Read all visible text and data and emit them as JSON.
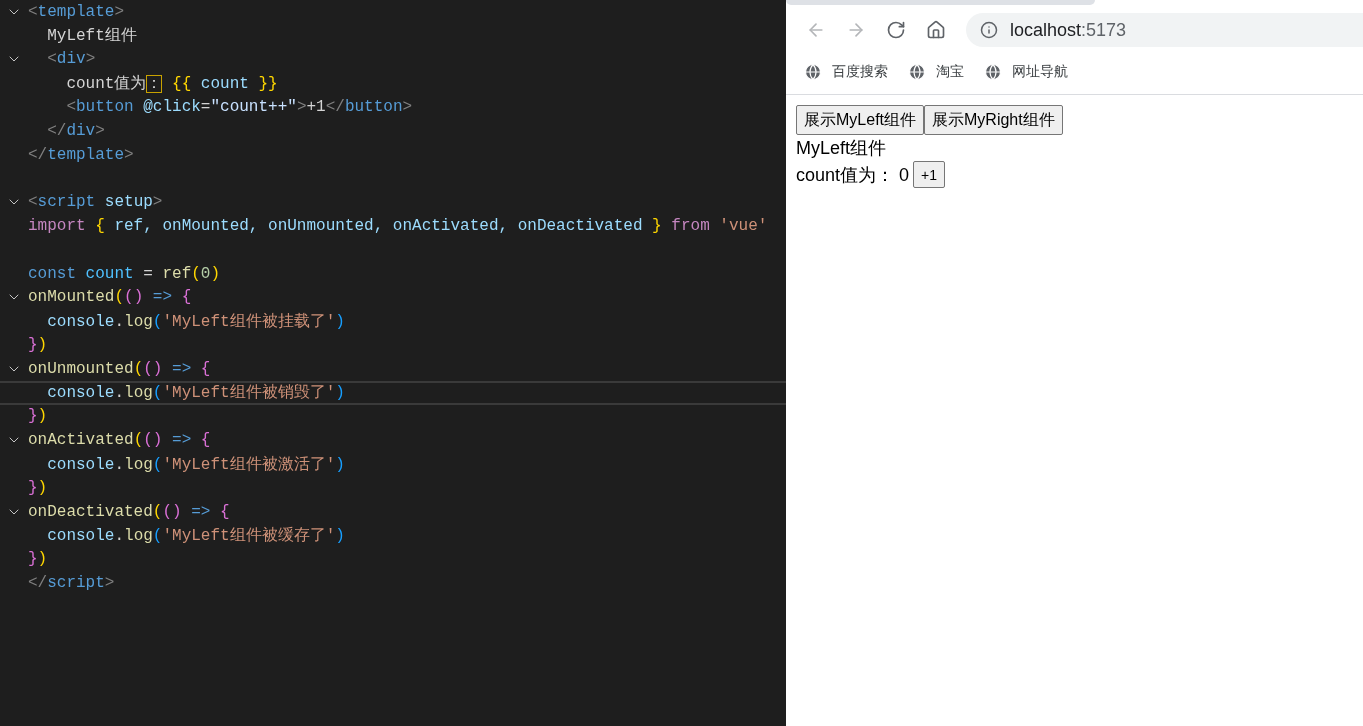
{
  "editor": {
    "lines": [
      {
        "fold": true,
        "current": false,
        "tokens": [
          {
            "text": "<",
            "kind": "punct"
          },
          {
            "text": "template",
            "kind": "tag"
          },
          {
            "text": ">",
            "kind": "punct"
          }
        ]
      },
      {
        "fold": false,
        "current": false,
        "tokens": [
          {
            "text": "  MyLeft组件",
            "kind": "plain"
          }
        ]
      },
      {
        "fold": true,
        "current": false,
        "tokens": [
          {
            "text": "  <",
            "kind": "punct"
          },
          {
            "text": "div",
            "kind": "tag"
          },
          {
            "text": ">",
            "kind": "punct"
          }
        ]
      },
      {
        "fold": false,
        "current": false,
        "tokens": [
          {
            "text": "    count值为",
            "kind": "plain"
          },
          {
            "text": "：",
            "kind": "ambiguous"
          },
          {
            "text": " {{",
            "kind": "bracket1"
          },
          {
            "text": " count ",
            "kind": "var"
          },
          {
            "text": "}}",
            "kind": "bracket1"
          }
        ]
      },
      {
        "fold": false,
        "current": false,
        "tokens": [
          {
            "text": "    <",
            "kind": "punct"
          },
          {
            "text": "button",
            "kind": "tag"
          },
          {
            "text": " @click",
            "kind": "attr"
          },
          {
            "text": "=",
            "kind": "plain"
          },
          {
            "text": "\"count++\"",
            "kind": "attrvalue"
          },
          {
            "text": ">",
            "kind": "punct"
          },
          {
            "text": "+1",
            "kind": "plain"
          },
          {
            "text": "</",
            "kind": "punct"
          },
          {
            "text": "button",
            "kind": "tag"
          },
          {
            "text": ">",
            "kind": "punct"
          }
        ]
      },
      {
        "fold": false,
        "current": false,
        "tokens": [
          {
            "text": "  </",
            "kind": "punct"
          },
          {
            "text": "div",
            "kind": "tag"
          },
          {
            "text": ">",
            "kind": "punct"
          }
        ]
      },
      {
        "fold": false,
        "current": false,
        "tokens": [
          {
            "text": "</",
            "kind": "punct"
          },
          {
            "text": "template",
            "kind": "tag"
          },
          {
            "text": ">",
            "kind": "punct"
          }
        ]
      },
      {
        "fold": false,
        "current": false
      },
      {
        "fold": true,
        "current": false,
        "tokens": [
          {
            "text": "<",
            "kind": "punct"
          },
          {
            "text": "script",
            "kind": "tag"
          },
          {
            "text": " setup",
            "kind": "attr"
          },
          {
            "text": ">",
            "kind": "punct"
          }
        ]
      },
      {
        "fold": false,
        "current": false,
        "tokens": [
          {
            "text": "import",
            "kind": "keyword"
          },
          {
            "text": " {",
            "kind": "bracket1"
          },
          {
            "text": " ref, onMounted, onUnmounted, onActivated, onDeactivated ",
            "kind": "var"
          },
          {
            "text": "}",
            "kind": "bracket1"
          },
          {
            "text": " from ",
            "kind": "keyword"
          },
          {
            "text": "'vue'",
            "kind": "string"
          }
        ]
      },
      {
        "fold": false,
        "current": false
      },
      {
        "fold": false,
        "current": false,
        "tokens": [
          {
            "text": "const",
            "kind": "storage"
          },
          {
            "text": " count",
            "kind": "const"
          },
          {
            "text": " = ",
            "kind": "plain"
          },
          {
            "text": "ref",
            "kind": "func"
          },
          {
            "text": "(",
            "kind": "bracket1"
          },
          {
            "text": "0",
            "kind": "number"
          },
          {
            "text": ")",
            "kind": "bracket1"
          }
        ]
      },
      {
        "fold": true,
        "current": false,
        "tokens": [
          {
            "text": "onMounted",
            "kind": "func"
          },
          {
            "text": "(",
            "kind": "bracket1"
          },
          {
            "text": "()",
            "kind": "bracket2"
          },
          {
            "text": " => ",
            "kind": "storage"
          },
          {
            "text": "{",
            "kind": "bracket2"
          }
        ]
      },
      {
        "fold": false,
        "current": false,
        "tokens": [
          {
            "text": "  console",
            "kind": "var"
          },
          {
            "text": ".",
            "kind": "plain"
          },
          {
            "text": "log",
            "kind": "func"
          },
          {
            "text": "(",
            "kind": "bracket3"
          },
          {
            "text": "'MyLeft组件被挂载了'",
            "kind": "string"
          },
          {
            "text": ")",
            "kind": "bracket3"
          }
        ]
      },
      {
        "fold": false,
        "current": false,
        "tokens": [
          {
            "text": "}",
            "kind": "bracket2"
          },
          {
            "text": ")",
            "kind": "bracket1"
          }
        ]
      },
      {
        "fold": true,
        "current": false,
        "tokens": [
          {
            "text": "onUnmounted",
            "kind": "func"
          },
          {
            "text": "(",
            "kind": "bracket1"
          },
          {
            "text": "()",
            "kind": "bracket2"
          },
          {
            "text": " => ",
            "kind": "storage"
          },
          {
            "text": "{",
            "kind": "bracket2"
          }
        ]
      },
      {
        "fold": false,
        "current": true,
        "tokens": [
          {
            "text": "  console",
            "kind": "var"
          },
          {
            "text": ".",
            "kind": "plain"
          },
          {
            "text": "log",
            "kind": "func"
          },
          {
            "text": "(",
            "kind": "bracket3"
          },
          {
            "text": "'MyLeft组件被销毁了'",
            "kind": "string"
          },
          {
            "text": ")",
            "kind": "bracket3"
          }
        ]
      },
      {
        "fold": false,
        "current": false,
        "tokens": [
          {
            "text": "}",
            "kind": "bracket2"
          },
          {
            "text": ")",
            "kind": "bracket1"
          }
        ]
      },
      {
        "fold": true,
        "current": false,
        "tokens": [
          {
            "text": "onActivated",
            "kind": "func"
          },
          {
            "text": "(",
            "kind": "bracket1"
          },
          {
            "text": "()",
            "kind": "bracket2"
          },
          {
            "text": " => ",
            "kind": "storage"
          },
          {
            "text": "{",
            "kind": "bracket2"
          }
        ]
      },
      {
        "fold": false,
        "current": false,
        "tokens": [
          {
            "text": "  console",
            "kind": "var"
          },
          {
            "text": ".",
            "kind": "plain"
          },
          {
            "text": "log",
            "kind": "func"
          },
          {
            "text": "(",
            "kind": "bracket3"
          },
          {
            "text": "'MyLeft组件被激活了'",
            "kind": "string"
          },
          {
            "text": ")",
            "kind": "bracket3"
          }
        ]
      },
      {
        "fold": false,
        "current": false,
        "tokens": [
          {
            "text": "}",
            "kind": "bracket2"
          },
          {
            "text": ")",
            "kind": "bracket1"
          }
        ]
      },
      {
        "fold": true,
        "current": false,
        "tokens": [
          {
            "text": "onDeactivated",
            "kind": "func"
          },
          {
            "text": "(",
            "kind": "bracket1"
          },
          {
            "text": "()",
            "kind": "bracket2"
          },
          {
            "text": " => ",
            "kind": "storage"
          },
          {
            "text": "{",
            "kind": "bracket2"
          }
        ]
      },
      {
        "fold": false,
        "current": false,
        "tokens": [
          {
            "text": "  console",
            "kind": "var"
          },
          {
            "text": ".",
            "kind": "plain"
          },
          {
            "text": "log",
            "kind": "func"
          },
          {
            "text": "(",
            "kind": "bracket3"
          },
          {
            "text": "'MyLeft组件被缓存了'",
            "kind": "string"
          },
          {
            "text": ")",
            "kind": "bracket3"
          }
        ]
      },
      {
        "fold": false,
        "current": false,
        "tokens": [
          {
            "text": "}",
            "kind": "bracket2"
          },
          {
            "text": ")",
            "kind": "bracket1"
          }
        ]
      },
      {
        "fold": false,
        "current": false,
        "tokens": [
          {
            "text": "</",
            "kind": "punct"
          },
          {
            "text": "script",
            "kind": "tag"
          },
          {
            "text": ">",
            "kind": "punct"
          }
        ]
      }
    ]
  },
  "browser": {
    "nav": [
      {
        "kind": "back",
        "disabled": true
      },
      {
        "kind": "forward",
        "disabled": true
      },
      {
        "kind": "reload",
        "disabled": false
      },
      {
        "kind": "home",
        "disabled": false
      }
    ],
    "address": {
      "host": "localhost",
      "port": ":5173"
    },
    "bookmarks": [
      {
        "label": "百度搜索"
      },
      {
        "label": "淘宝"
      },
      {
        "label": "网址导航"
      }
    ],
    "page": {
      "buttons": [
        "展示MyLeft组件",
        "展示MyRight组件"
      ],
      "heading": "MyLeft组件",
      "count_text": "count值为： 0",
      "increment_button": "+1"
    }
  }
}
